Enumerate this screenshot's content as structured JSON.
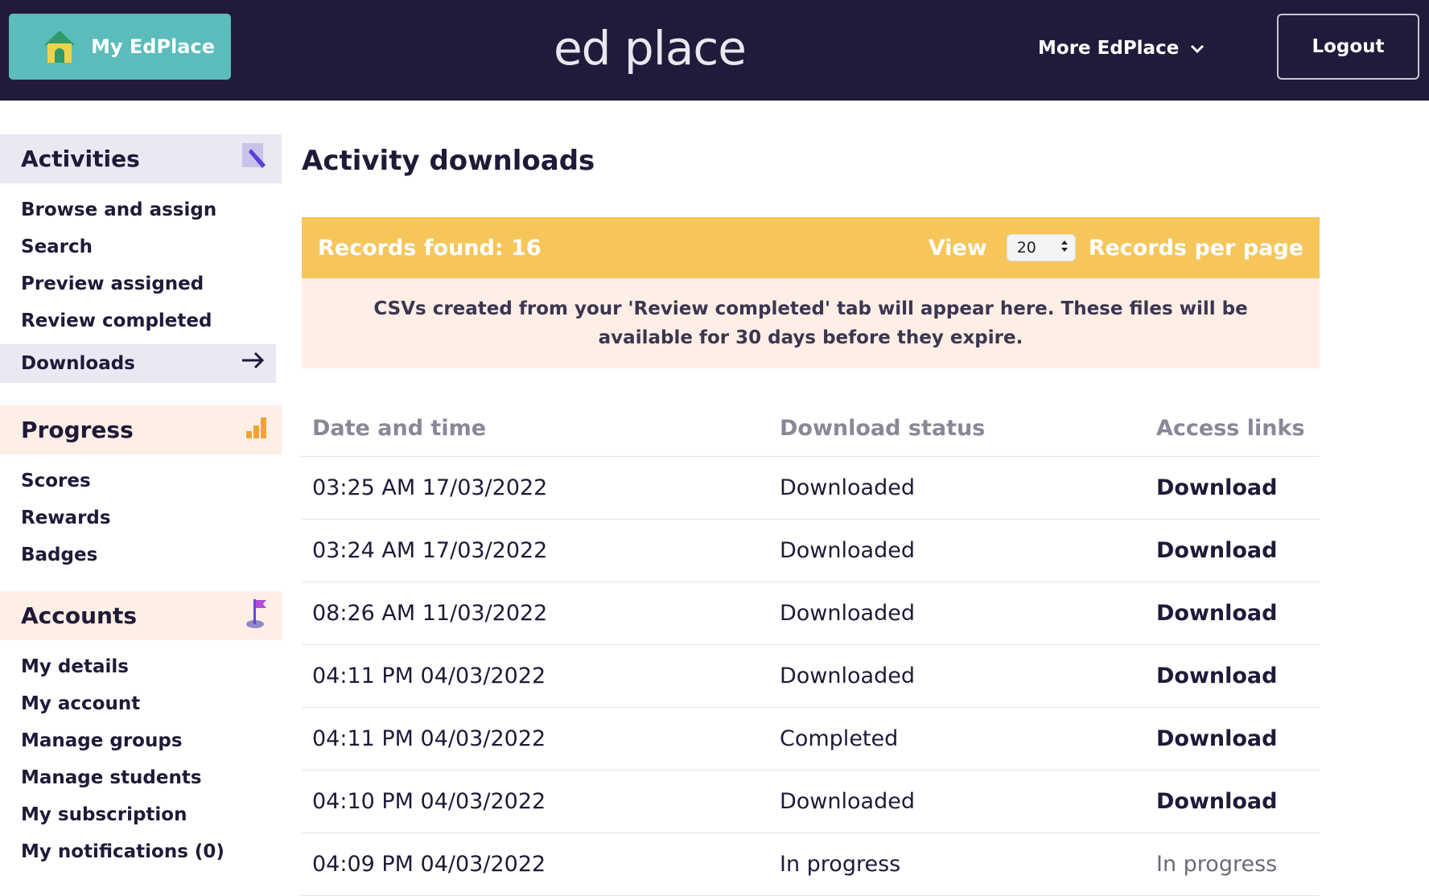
{
  "header": {
    "home_label": "My EdPlace",
    "logo_text": "ed place",
    "more_label": "More EdPlace",
    "logout_label": "Logout"
  },
  "sidebar": {
    "activities": {
      "title": "Activities",
      "items": [
        "Browse and assign",
        "Search",
        "Preview assigned",
        "Review completed"
      ],
      "active_item": "Downloads"
    },
    "progress": {
      "title": "Progress",
      "items": [
        "Scores",
        "Rewards",
        "Badges"
      ]
    },
    "accounts": {
      "title": "Accounts",
      "items": [
        "My details",
        "My account",
        "Manage groups",
        "Manage students",
        "My subscription",
        "My notifications (0)"
      ]
    }
  },
  "main": {
    "title": "Activity downloads",
    "records_found": "Records found: 16",
    "view_label": "View",
    "per_page_value": "20",
    "per_page_label": "Records per page",
    "info_text": "CSVs created from your 'Review completed' tab will appear here. These files will be available for 30 days before they expire.",
    "table": {
      "headers": [
        "Date and time",
        "Download status",
        "Access links"
      ],
      "rows": [
        {
          "datetime": "03:25 AM 17/03/2022",
          "status": "Downloaded",
          "link": "Download",
          "link_active": true
        },
        {
          "datetime": "03:24 AM 17/03/2022",
          "status": "Downloaded",
          "link": "Download",
          "link_active": true
        },
        {
          "datetime": "08:26 AM 11/03/2022",
          "status": "Downloaded",
          "link": "Download",
          "link_active": true
        },
        {
          "datetime": "04:11 PM 04/03/2022",
          "status": "Downloaded",
          "link": "Download",
          "link_active": true
        },
        {
          "datetime": "04:11 PM 04/03/2022",
          "status": "Completed",
          "link": "Download",
          "link_active": true
        },
        {
          "datetime": "04:10 PM 04/03/2022",
          "status": "Downloaded",
          "link": "Download",
          "link_active": true
        },
        {
          "datetime": "04:09 PM 04/03/2022",
          "status": "In progress",
          "link": "In progress",
          "link_active": false
        }
      ]
    }
  },
  "colors": {
    "header_bg": "#211a3b",
    "home_button": "#5bbcbb",
    "records_bar": "#f6c65b",
    "info_bg": "#fdeee6",
    "activities_bg": "#e9e8f3"
  },
  "icons": [
    "house-icon",
    "chevron-down-icon",
    "pencil-icon",
    "arrow-right-icon",
    "bar-chart-icon",
    "flag-icon",
    "select-arrows-icon"
  ]
}
